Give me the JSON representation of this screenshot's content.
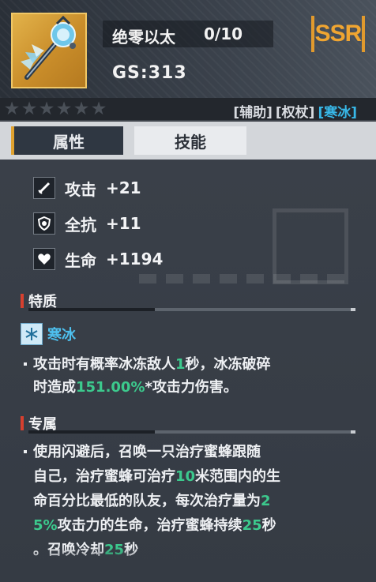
{
  "item": {
    "name": "绝零以太",
    "level": "0/10",
    "gs": "GS:313",
    "rarity": "SSR",
    "icon": "ice-staff-icon",
    "colors": {
      "rarity": "#f0a531",
      "icon_bg": "#d9a23c"
    }
  },
  "stars": {
    "count": 6,
    "filled": 0
  },
  "tags": [
    "[辅助]",
    "[权杖]",
    "[寒冰]"
  ],
  "tabs": [
    {
      "label": "属性",
      "active": true
    },
    {
      "label": "技能",
      "active": false
    }
  ],
  "stats": [
    {
      "icon": "sword-icon",
      "label": "攻击",
      "value": "+21"
    },
    {
      "icon": "shield-icon",
      "label": "全抗",
      "value": "+11"
    },
    {
      "icon": "heart-icon",
      "label": "生命",
      "value": "+1194"
    }
  ],
  "trait": {
    "title": "特质",
    "element_icon": "snowflake-icon",
    "element_name": "寒冰",
    "desc": {
      "p1": "攻击时有概率冰冻敌人",
      "n1": "1",
      "p2": "秒，冰冻破碎",
      "p3": "时造成",
      "n2": "151.00%",
      "p4": "*攻击力伤害。"
    }
  },
  "exclusive": {
    "title": "专属",
    "desc": {
      "l1": "使用闪避后，召唤一只治疗蜜蜂跟随",
      "l2a": "自己，治疗蜜蜂可治疗",
      "n1": "10",
      "l2b": "米范围内的生",
      "l3a": "命百分比最低的队友，每次治疗量为",
      "n2a": "2",
      "n2b": "5%",
      "l4a": "攻击力的生命，治疗蜜蜂持续",
      "n3": "25",
      "l4b": "秒",
      "l5a": "。召唤冷却",
      "n4": "25",
      "l5b": "秒"
    }
  },
  "colors": {
    "highlight": "#3cc98d",
    "accent_tag": "#38b8e8",
    "section_bar": "#d6402f"
  }
}
